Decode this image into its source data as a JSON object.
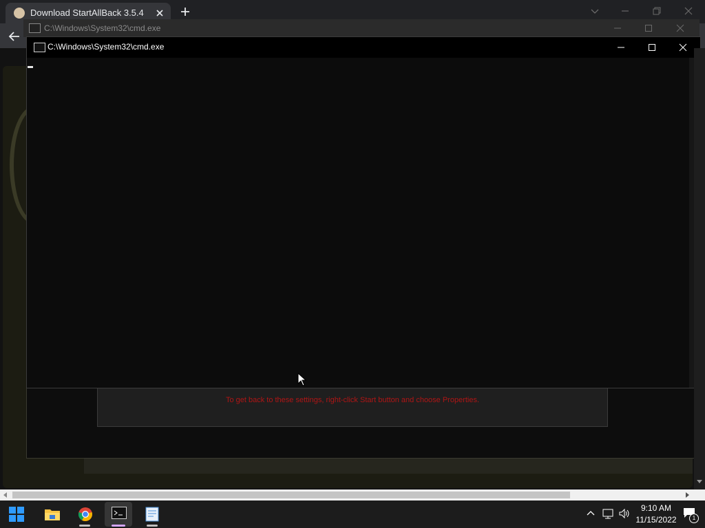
{
  "browser": {
    "tab_title": "Download StartAllBack 3.5.4"
  },
  "back_window": {
    "title": "C:\\Windows\\System32\\cmd.exe"
  },
  "cmd_window": {
    "title": "C:\\Windows\\System32\\cmd.exe"
  },
  "settings_dialog": {
    "hint": "To get back to these settings, right-click Start button and choose Properties."
  },
  "taskbar": {
    "apps": [
      "start-button",
      "file-explorer",
      "google-chrome",
      "command-prompt",
      "notepad"
    ],
    "active_app": "command-prompt",
    "clock_time": "9:10 AM",
    "clock_date": "11/15/2022",
    "notification_count": "1"
  },
  "colors": {
    "hint_text": "#b01515",
    "windows_blue": "#2f9bff",
    "cmd_indicator": "#d5a5ff"
  },
  "icons": [
    "favicon-icon",
    "close-icon",
    "plus-icon",
    "chevron-down-icon",
    "minimize-icon",
    "maximize-icon",
    "back-arrow-icon",
    "cmd-icon",
    "windows-logo-icon",
    "folder-icon",
    "chrome-icon",
    "notepad-icon",
    "chevron-up-icon",
    "network-icon",
    "volume-icon",
    "notification-icon",
    "mouse-pointer-icon"
  ]
}
